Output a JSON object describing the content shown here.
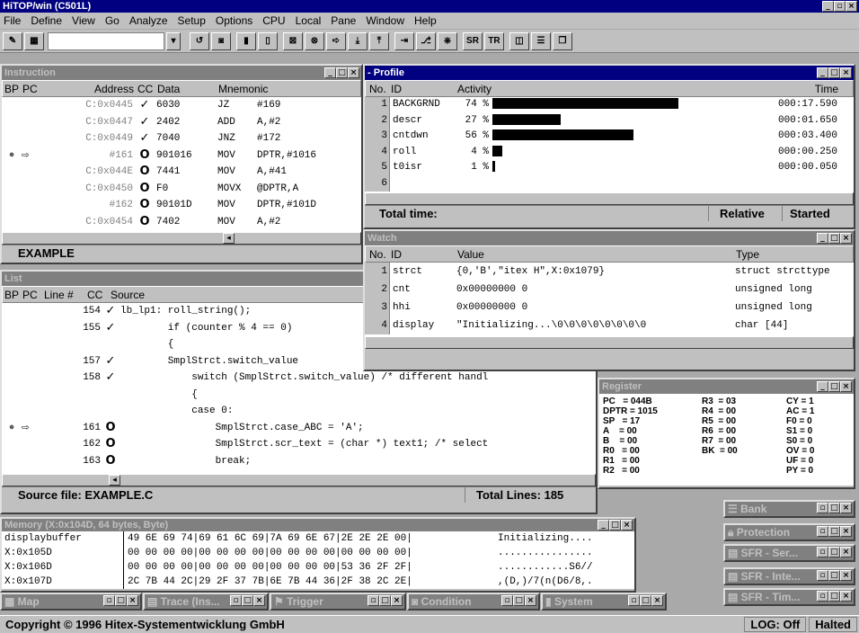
{
  "app": {
    "title": "HiTOP/win (C501L)"
  },
  "menu": [
    "File",
    "Define",
    "View",
    "Go",
    "Analyze",
    "Setup",
    "Options",
    "CPU",
    "Local",
    "Pane",
    "Window",
    "Help"
  ],
  "toolbar": {
    "icons": [
      "SR",
      "TR"
    ]
  },
  "instruction": {
    "title": "Instruction",
    "headers": [
      "BP",
      "PC",
      "Address",
      "CC",
      "Data",
      "Mnemonic"
    ],
    "rows": [
      {
        "addr": "C:0x0445",
        "cc": "✓",
        "data": "6030",
        "mn": "JZ",
        "op": "#169",
        "bp": "",
        "pc": ""
      },
      {
        "addr": "C:0x0447",
        "cc": "✓",
        "data": "2402",
        "mn": "ADD",
        "op": "A,#2",
        "bp": "",
        "pc": ""
      },
      {
        "addr": "C:0x0449",
        "cc": "✓",
        "data": "7040",
        "mn": "JNZ",
        "op": "#172",
        "bp": "",
        "pc": ""
      },
      {
        "addr": "#161",
        "cc": "O",
        "data": "901016",
        "mn": "MOV",
        "op": "DPTR,#1016",
        "bp": "●",
        "pc": "⇨"
      },
      {
        "addr": "C:0x044E",
        "cc": "O",
        "data": "7441",
        "mn": "MOV",
        "op": "A,#41",
        "bp": "",
        "pc": ""
      },
      {
        "addr": "C:0x0450",
        "cc": "O",
        "data": "F0",
        "mn": "MOVX",
        "op": "@DPTR,A",
        "bp": "",
        "pc": ""
      },
      {
        "addr": "#162",
        "cc": "O",
        "data": "90101D",
        "mn": "MOV",
        "op": "DPTR,#101D",
        "bp": "",
        "pc": ""
      },
      {
        "addr": "C:0x0454",
        "cc": "O",
        "data": "7402",
        "mn": "MOV",
        "op": "A,#2",
        "bp": "",
        "pc": ""
      }
    ],
    "status": "EXAMPLE"
  },
  "profile": {
    "title": "Profile",
    "headers": [
      "No.",
      "ID",
      "Activity",
      "Time"
    ],
    "rows": [
      {
        "no": "1",
        "id": "BACKGRND",
        "pct": "74 %",
        "frac": 0.74,
        "time": "000:17.590"
      },
      {
        "no": "2",
        "id": "descr",
        "pct": "27 %",
        "frac": 0.27,
        "time": "000:01.650"
      },
      {
        "no": "3",
        "id": "cntdwn",
        "pct": "56 %",
        "frac": 0.56,
        "time": "000:03.400"
      },
      {
        "no": "4",
        "id": "roll",
        "pct": "4 %",
        "frac": 0.04,
        "time": "000:00.250"
      },
      {
        "no": "5",
        "id": "t0isr",
        "pct": "1 %",
        "frac": 0.01,
        "time": "000:00.050"
      },
      {
        "no": "6",
        "id": "",
        "pct": "",
        "frac": 0,
        "time": ""
      }
    ],
    "total_label": "Total time:",
    "relative": "Relative",
    "started": "Started"
  },
  "watch": {
    "title": "Watch",
    "headers": [
      "No.",
      "ID",
      "Value",
      "Type"
    ],
    "rows": [
      {
        "no": "1",
        "id": "strct",
        "val": "{0,'B',\"itex H\",X:0x1079}",
        "type": "struct strcttype"
      },
      {
        "no": "2",
        "id": "cnt",
        "val": "0x00000000 0",
        "type": "unsigned long"
      },
      {
        "no": "3",
        "id": "hhi",
        "val": "0x00000000 0",
        "type": "unsigned long"
      },
      {
        "no": "4",
        "id": "display",
        "val": "\"Initializing...\\0\\0\\0\\0\\0\\0\\0\\0",
        "type": "char [44]"
      }
    ]
  },
  "list": {
    "title": "List",
    "headers": [
      "BP",
      "PC",
      "Line #",
      "CC",
      "Source"
    ],
    "rows": [
      {
        "line": "154",
        "cc": "✓",
        "src": "lb_lp1: roll_string();",
        "bp": "",
        "pc": ""
      },
      {
        "line": "155",
        "cc": "✓",
        "src": "        if (counter % 4 == 0)",
        "bp": "",
        "pc": ""
      },
      {
        "line": "",
        "cc": "",
        "src": "        {",
        "bp": "",
        "pc": ""
      },
      {
        "line": "157",
        "cc": "✓",
        "src": "        SmplStrct.switch_value",
        "bp": "",
        "pc": ""
      },
      {
        "line": "158",
        "cc": "✓",
        "src": "            switch (SmplStrct.switch_value) /* different handl",
        "bp": "",
        "pc": ""
      },
      {
        "line": "",
        "cc": "",
        "src": "            {",
        "bp": "",
        "pc": ""
      },
      {
        "line": "",
        "cc": "",
        "src": "            case 0:",
        "bp": "",
        "pc": ""
      },
      {
        "line": "161",
        "cc": "O",
        "src": "                SmplStrct.case_ABC = 'A';",
        "bp": "●",
        "pc": "⇨"
      },
      {
        "line": "162",
        "cc": "O",
        "src": "                SmplStrct.scr_text = (char *) text1; /* select",
        "bp": "",
        "pc": ""
      },
      {
        "line": "163",
        "cc": "O",
        "src": "                break;",
        "bp": "",
        "pc": ""
      }
    ],
    "source_file": "Source file: EXAMPLE.C",
    "total_lines": "Total Lines: 185"
  },
  "register": {
    "title": "Register",
    "col1": [
      "PC   = 044B",
      "DPTR = 1015",
      "SP   = 17",
      "A    = 00",
      "B    = 00",
      "R0   = 00",
      "R1   = 00",
      "R2   = 00"
    ],
    "col2": [
      "R3  = 03",
      "R4  = 00",
      "R5  = 00",
      "R6  = 00",
      "R7  = 00",
      "BK  = 00"
    ],
    "col3": [
      "CY = 1",
      "AC = 1",
      "F0 = 0",
      "S1 = 0",
      "S0 = 0",
      "OV = 0",
      "UF = 0",
      "PY = 0"
    ]
  },
  "memory": {
    "title": "Memory (X:0x104D, 64 bytes, Byte)",
    "rows": [
      {
        "addr": "displaybuffer",
        "hex": "49 6E 69 74|69 61 6C 69|7A 69 6E 67|2E 2E 2E 00|",
        "ascii": "Initializing...."
      },
      {
        "addr": "X:0x105D",
        "hex": "00 00 00 00|00 00 00 00|00 00 00 00|00 00 00 00|",
        "ascii": "................"
      },
      {
        "addr": "X:0x106D",
        "hex": "00 00 00 00|00 00 00 00|00 00 00 00|53 36 2F 2F|",
        "ascii": "............S6//"
      },
      {
        "addr": "X:0x107D",
        "hex": "2C 7B 44 2C|29 2F 37 7B|6E 7B 44 36|2F 38 2C 2E|",
        "ascii": ",(D,)/7(n(D6/8,."
      }
    ]
  },
  "minimized": {
    "bank": "Bank",
    "protection": "Protection",
    "sfr_ser": "SFR - Ser...",
    "sfr_inte": "SFR - Inte...",
    "sfr_tim": "SFR - Tim...",
    "map": "Map",
    "trace": "Trace (Ins...",
    "trigger": "Trigger",
    "condition": "Condition",
    "system": "System"
  },
  "statusbar": {
    "copyright": "Copyright © 1996 Hitex-Systementwicklung GmbH",
    "log": "LOG: Off",
    "state": "Halted"
  }
}
